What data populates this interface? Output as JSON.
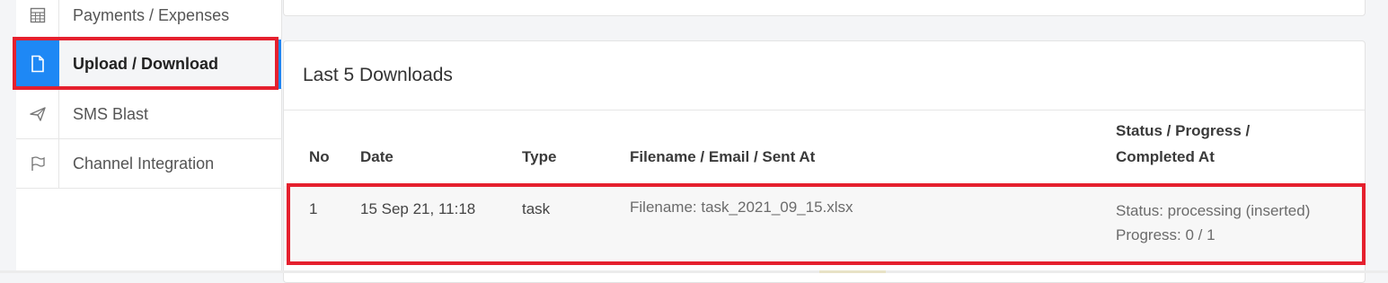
{
  "sidebar": {
    "items": [
      {
        "label": "Payments / Expenses",
        "icon": "calculator-icon",
        "active": false
      },
      {
        "label": "Upload / Download",
        "icon": "document-icon",
        "active": true
      },
      {
        "label": "SMS Blast",
        "icon": "paper-plane-icon",
        "active": false
      },
      {
        "label": "Channel Integration",
        "icon": "flag-icon",
        "active": false
      }
    ]
  },
  "downloads": {
    "title": "Last 5 Downloads",
    "columns": {
      "no": "No",
      "date": "Date",
      "type": "Type",
      "file": "Filename / Email / Sent At",
      "status_line1": "Status / Progress /",
      "status_line2": "Completed At"
    },
    "rows": [
      {
        "no": "1",
        "date": "15 Sep 21, 11:18",
        "type": "task",
        "filename": "Filename: task_2021_09_15.xlsx",
        "status": "Status: processing (inserted)",
        "progress": "Progress: 0 / 1"
      }
    ]
  },
  "colors": {
    "accent": "#1e88f5",
    "highlight": "#e5202e"
  }
}
